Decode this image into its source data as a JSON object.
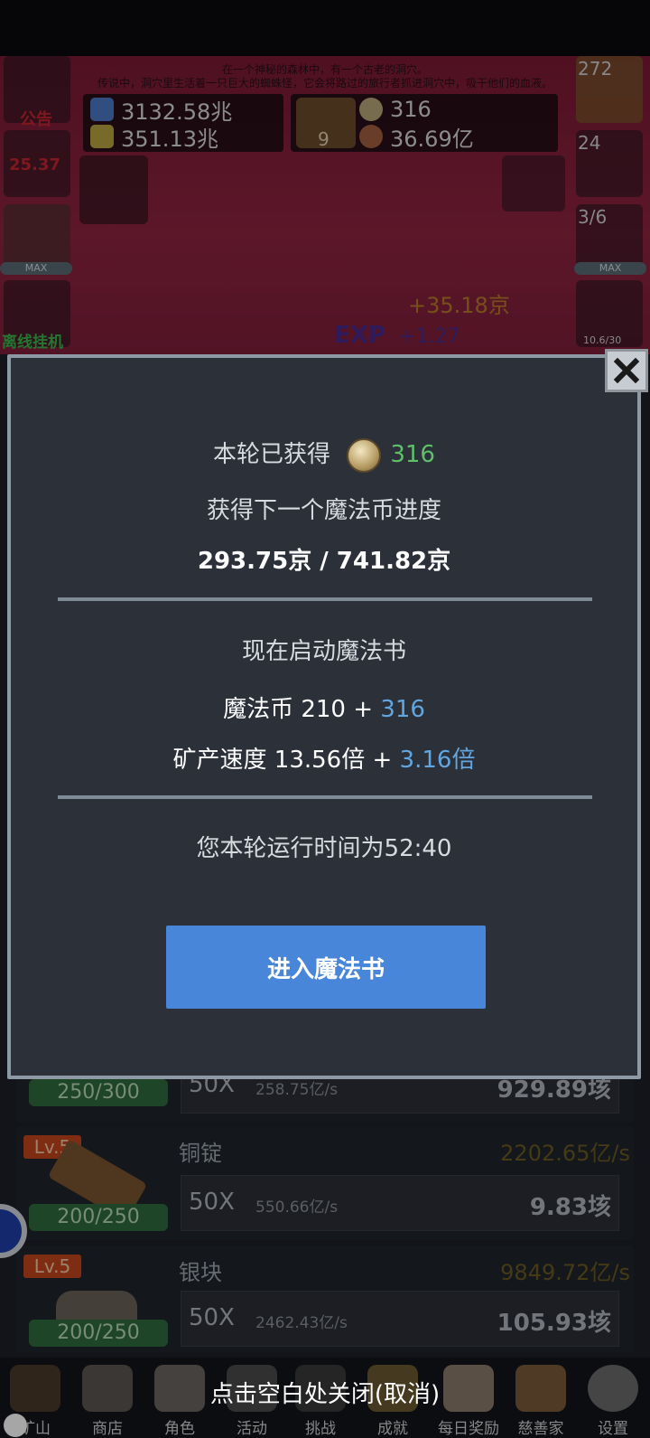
{
  "story": {
    "line1": "在一个神秘的森林中，有一个古老的洞穴。",
    "line2": "传说中，洞穴里生活着一只巨大的蜘蛛怪，它会将路过的旅行者抓进洞穴中，吸干他们的血液。"
  },
  "resources": {
    "blue_potion": "3132.58兆",
    "yellow_potion": "351.13兆",
    "book_count": "9",
    "coin": "316",
    "meat": "36.69亿"
  },
  "left_tiles": {
    "notice": "公告",
    "torch": "25.37",
    "chef_max": "MAX",
    "offline": "离线挂机"
  },
  "right_tiles": {
    "potion_count": "272",
    "chest_count": "24",
    "slime_count": "3/6",
    "slime_max": "MAX",
    "sword_count": "10.6/30"
  },
  "floating": {
    "gain": "+35.18京",
    "exp_label": "EXP",
    "exp_gain": "+1.27"
  },
  "dialog": {
    "earned_label": "本轮已获得",
    "earned_value": "316",
    "progress_label": "获得下一个魔法币进度",
    "progress_value": "293.75京 / 741.82京",
    "start_label": "现在启动魔法书",
    "coin_label": "魔法币 210 + ",
    "coin_add": "316",
    "speed_label": "矿产速度 13.56倍 + ",
    "speed_add": "3.16倍",
    "runtime": "您本轮运行时间为52:40",
    "enter_button": "进入魔法书"
  },
  "dismiss_hint": "点击空白处关闭(取消)",
  "rows": [
    {
      "level": "",
      "name": "",
      "rate": "",
      "progress": "250/300",
      "buy_x": "50X",
      "buy_rate": "258.75亿/s",
      "cost": "929.89垓"
    },
    {
      "level": "Lv.5",
      "name": "铜锭",
      "rate": "2202.65亿/s",
      "progress": "200/250",
      "buy_x": "50X",
      "buy_rate": "550.66亿/s",
      "cost": "9.83垓"
    },
    {
      "level": "Lv.5",
      "name": "银块",
      "rate": "9849.72亿/s",
      "progress": "200/250",
      "buy_x": "50X",
      "buy_rate": "2462.43亿/s",
      "cost": "105.93垓"
    }
  ],
  "nav": [
    "矿山",
    "商店",
    "角色",
    "活动",
    "挑战",
    "成就",
    "每日奖励",
    "慈善家",
    "设置"
  ],
  "colors": {
    "dialog_bg": "#2b3039",
    "accent_green": "#5fbf6a",
    "accent_blue": "#61a6e0",
    "button_blue": "#4786d9"
  }
}
